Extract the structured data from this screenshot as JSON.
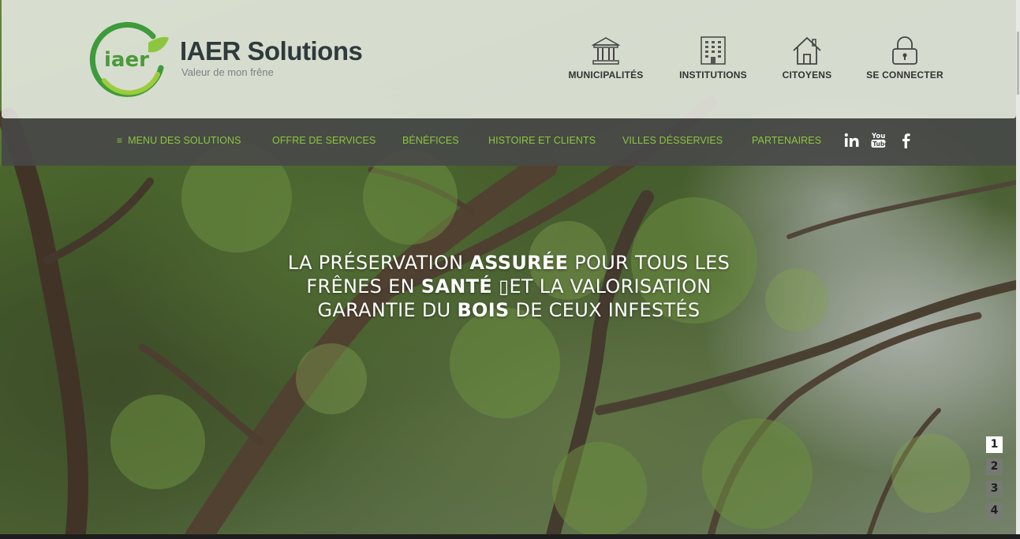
{
  "brand": {
    "logo_mark_text": "iaer",
    "name": "IAER Solutions",
    "tagline": "Valeur de mon frêne"
  },
  "top_nav": [
    {
      "label": "MUNICIPALITÉS",
      "icon": "building-columns-icon"
    },
    {
      "label": "INSTITUTIONS",
      "icon": "office-building-icon"
    },
    {
      "label": "CITOYENS",
      "icon": "house-icon"
    },
    {
      "label": "SE CONNECTER",
      "icon": "padlock-icon"
    }
  ],
  "main_nav": {
    "menu_label": "MENU DES SOLUTIONS",
    "menu_icon": "hamburger-icon",
    "links": [
      "OFFRE DE SERVICES",
      "BÉNÉFICES",
      "HISTOIRE ET CLIENTS",
      "VILLES DÉSSERVIES",
      "PARTENAIRES"
    ],
    "social": [
      "linkedin-icon",
      "youtube-icon",
      "facebook-icon"
    ],
    "link_color": "#8cc63f"
  },
  "hero": {
    "line1_a": "LA PRÉSERVATION ",
    "line1_b": "ASSURÉE",
    "line1_c": " POUR TOUS LES",
    "line2_a": "FRÊNES EN ",
    "line2_b": "SANTÉ",
    "line2_c": " ▯",
    "line2_d": "ET LA VALORISATION",
    "line3_a": "GARANTIE DU ",
    "line3_b": "BOIS",
    "line3_c": " DE CEUX INFESTÉS"
  },
  "slider": {
    "pages": [
      "1",
      "2",
      "3",
      "4"
    ],
    "active_page": "1"
  }
}
